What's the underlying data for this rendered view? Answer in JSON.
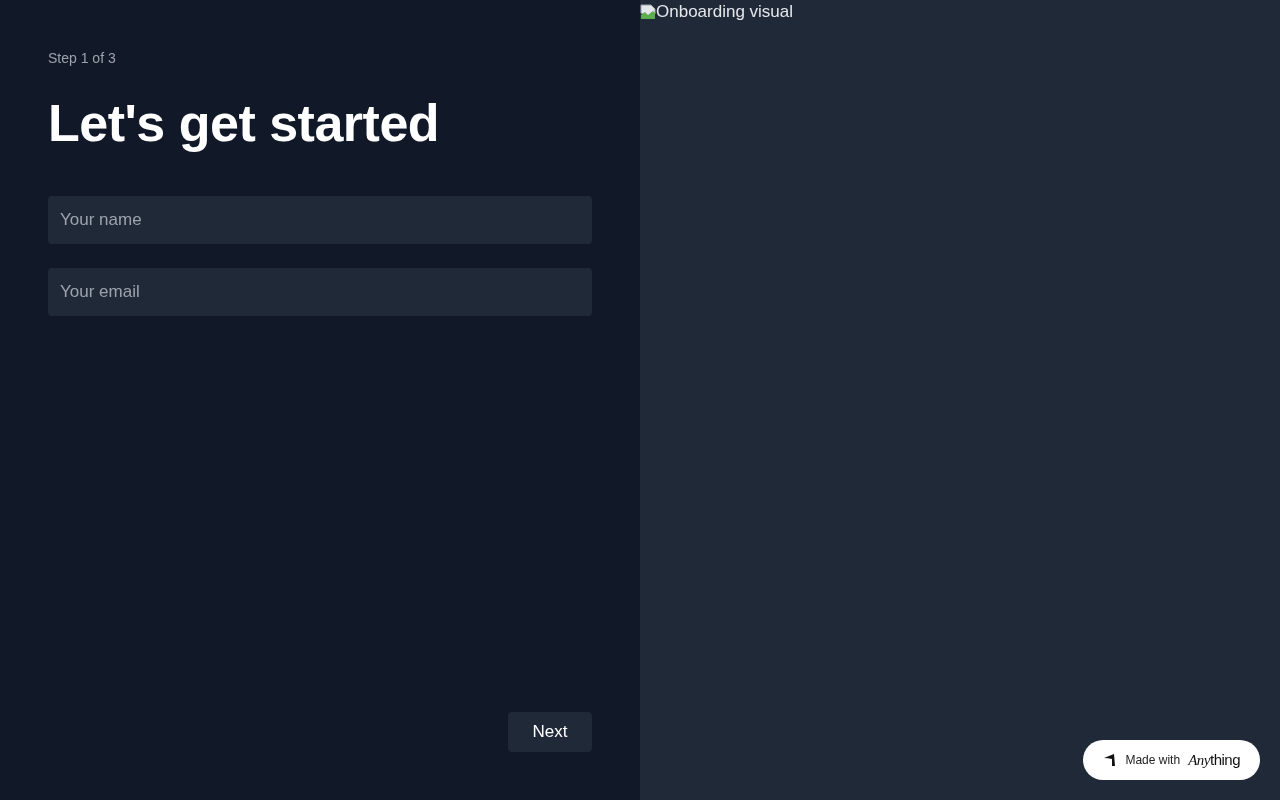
{
  "step": "Step 1 of 3",
  "title": "Let's get started",
  "fields": [
    {
      "placeholder": "Your name"
    },
    {
      "placeholder": "Your email"
    }
  ],
  "next_button": "Next",
  "visual": {
    "alt": "Onboarding visual"
  },
  "badge": {
    "label": "Made with",
    "logo": {
      "italic_part": "Any",
      "plain_part": "thing"
    }
  }
}
